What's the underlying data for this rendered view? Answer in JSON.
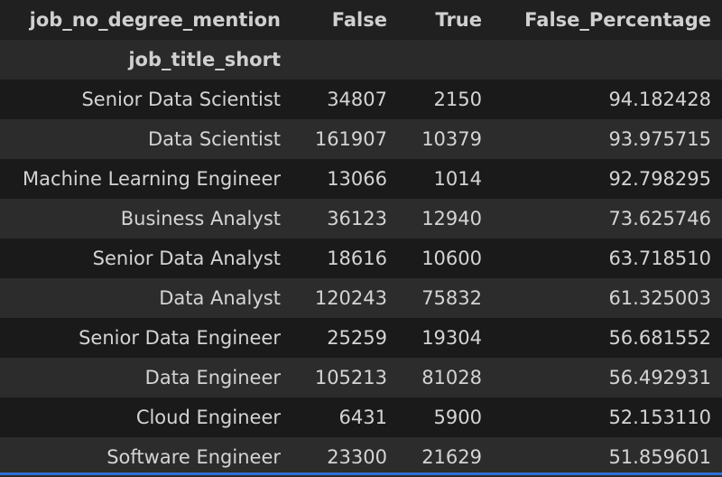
{
  "table": {
    "columns_name": "job_no_degree_mention",
    "columns": [
      "False",
      "True",
      "False_Percentage"
    ],
    "index_name": "job_title_short",
    "rows": [
      {
        "title": "Senior Data Scientist",
        "false": "34807",
        "true": "2150",
        "pct": "94.182428"
      },
      {
        "title": "Data Scientist",
        "false": "161907",
        "true": "10379",
        "pct": "93.975715"
      },
      {
        "title": "Machine Learning Engineer",
        "false": "13066",
        "true": "1014",
        "pct": "92.798295"
      },
      {
        "title": "Business Analyst",
        "false": "36123",
        "true": "12940",
        "pct": "73.625746"
      },
      {
        "title": "Senior Data Analyst",
        "false": "18616",
        "true": "10600",
        "pct": "63.718510"
      },
      {
        "title": "Data Analyst",
        "false": "120243",
        "true": "75832",
        "pct": "61.325003"
      },
      {
        "title": "Senior Data Engineer",
        "false": "25259",
        "true": "19304",
        "pct": "56.681552"
      },
      {
        "title": "Data Engineer",
        "false": "105213",
        "true": "81028",
        "pct": "56.492931"
      },
      {
        "title": "Cloud Engineer",
        "false": "6431",
        "true": "5900",
        "pct": "52.153110"
      },
      {
        "title": "Software Engineer",
        "false": "23300",
        "true": "21629",
        "pct": "51.859601"
      }
    ]
  },
  "colors": {
    "background": "#1e1e1e",
    "row_dark": "#1a1a1a",
    "row_light": "#2c2c2c",
    "text": "#d4d4d4",
    "accent": "#2f6fd6"
  }
}
